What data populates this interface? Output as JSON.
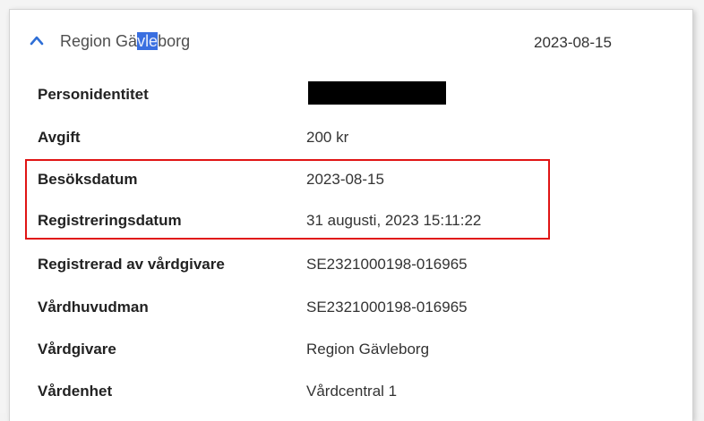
{
  "header": {
    "title_before": "Region Gä",
    "title_highlight": "vle",
    "title_after": "borg",
    "date": "2023-08-15"
  },
  "rows": [
    {
      "label": "Personidentitet",
      "value": ""
    },
    {
      "label": "Avgift",
      "value": "200 kr"
    },
    {
      "label": "Besöksdatum",
      "value": "2023-08-15"
    },
    {
      "label": "Registreringsdatum",
      "value": "31 augusti, 2023 15:11:22"
    },
    {
      "label": "Registrerad av vårdgivare",
      "value": "SE2321000198-016965"
    },
    {
      "label": "Vårdhuvudman",
      "value": "SE2321000198-016965"
    },
    {
      "label": "Vårdgivare",
      "value": "Region Gävleborg"
    },
    {
      "label": "Vårdenhet",
      "value": "Vårdcentral 1"
    }
  ],
  "colors": {
    "accent": "#3a6fe0",
    "annotation_box": "#e01414",
    "redaction": "#000000"
  },
  "icons": {
    "collapse": "chevron-up-icon"
  }
}
